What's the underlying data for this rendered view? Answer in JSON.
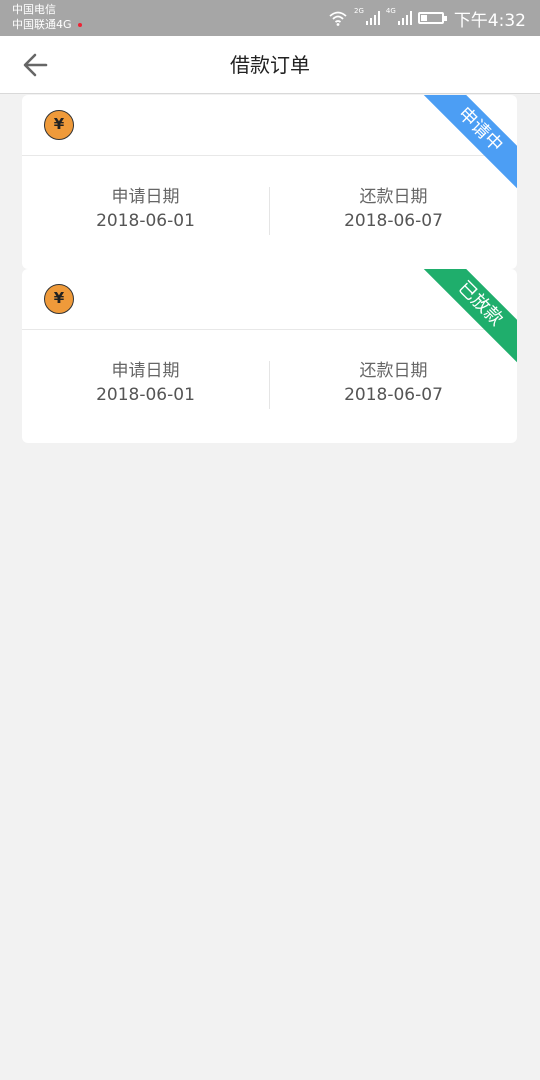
{
  "status_bar": {
    "carrier_line1": "中国电信",
    "carrier_line2": "中国联通4G",
    "net_label_1": "2G",
    "net_label_2": "4G",
    "time": "下午4:32",
    "battery_level": 0.3,
    "icons": [
      "wifi-icon",
      "signal-icon",
      "battery-icon"
    ]
  },
  "nav": {
    "back_icon": "arrow-left-icon",
    "title": "借款订单"
  },
  "orders": [
    {
      "icon": "yuan-coin-icon",
      "coin_symbol": "¥",
      "status": "申请中",
      "status_color": "#4c9ef4",
      "apply_label": "申请日期",
      "apply_date": "2018-06-01",
      "repay_label": "还款日期",
      "repay_date": "2018-06-07"
    },
    {
      "icon": "yuan-coin-icon",
      "coin_symbol": "¥",
      "status": "已放款",
      "status_color": "#1fae6c",
      "apply_label": "申请日期",
      "apply_date": "2018-06-01",
      "repay_label": "还款日期",
      "repay_date": "2018-06-07"
    }
  ]
}
